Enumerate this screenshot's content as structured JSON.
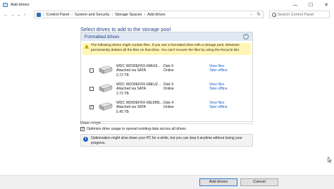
{
  "window": {
    "title": "Add drives",
    "min_glyph": "—",
    "max_glyph": "☐",
    "close_glyph": "✕"
  },
  "navigation": {
    "back_glyph": "←",
    "forward_glyph": "→",
    "recent_glyph": "⌄",
    "up_glyph": "↑",
    "breadcrumb": [
      "Control Panel",
      "System and Security",
      "Storage Spaces",
      "Add drives"
    ],
    "separator": "›",
    "refresh_glyph": "↻",
    "dropdown_glyph": "⌄",
    "search_placeholder": "Search Control Panel"
  },
  "main": {
    "heading": "Select drives to add to the storage pool",
    "group_title": "Formatted drives",
    "collapse_glyph": "⌃",
    "warning_line1": "The following drives might contain files. If you use a formatted drive with a storage pool, Windows",
    "warning_line2": "permanently deletes all the files on that drive. You can't recover the files by using the Recycle Bin.",
    "drives": [
      {
        "name": "WDC WD30EFRX-68AX9...",
        "bus": "Attached via SATA",
        "size": "2.72 TB",
        "disk": "Disk 6",
        "status": "Online",
        "link1": "View files",
        "link2": "Take offline",
        "checked": false
      },
      {
        "name": "WDC WD30EFRX-68EUZ...",
        "bus": "Attached via SATA",
        "size": "2.72 TB",
        "disk": "Disk 5",
        "status": "Online",
        "link1": "View files",
        "link2": "Take offline",
        "checked": false
      },
      {
        "name": "WDC WD60EFRX-68L0BN...",
        "bus": "Attached via SATA",
        "size": "5.45 TB",
        "disk": "Disk 4",
        "status": "Online",
        "link1": "View files",
        "link2": "Take offline",
        "checked": true
      }
    ],
    "check_glyph": "✓"
  },
  "usage": {
    "label": "Drive usage",
    "optimize_label": "Optimize drive usage to spread existing data across all drives",
    "optimize_checked": true,
    "info_glyph": "i",
    "info_line1": "Optimization might slow down your PC for a while, but you can stop it anytime without losing your",
    "info_line2": "progress."
  },
  "footer": {
    "add_label": "Add drives",
    "cancel_label": "Cancel"
  },
  "colors": {
    "heading": "#1e3f86",
    "link": "#1c62c4",
    "warning_bg": "#fff5b5",
    "group_header_bg": "#dfe8f3"
  }
}
